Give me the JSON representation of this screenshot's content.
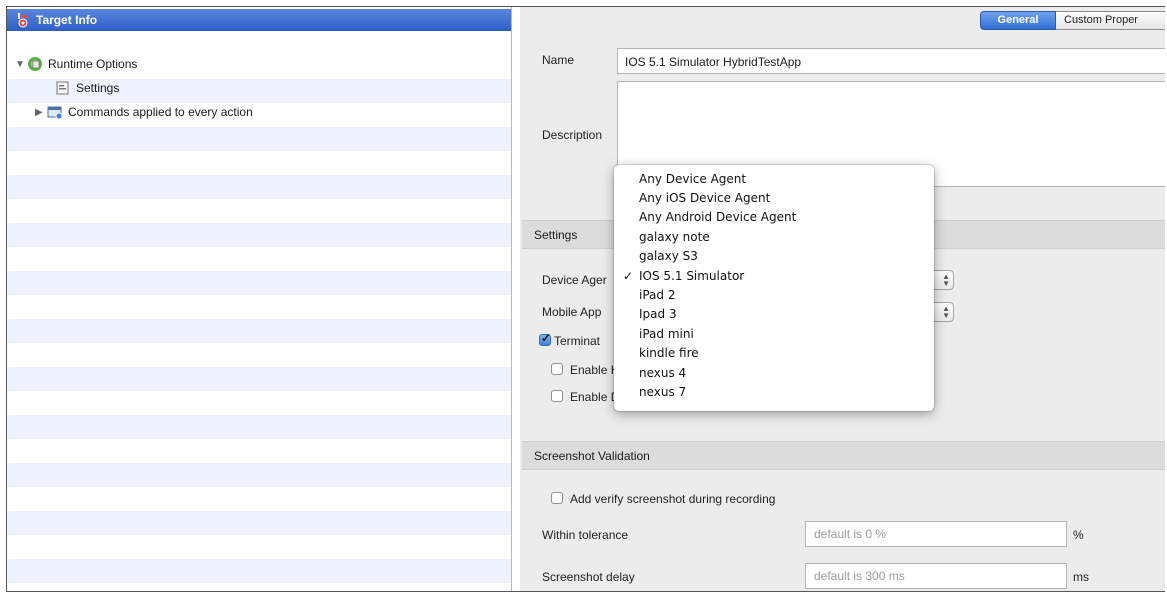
{
  "tree": {
    "selected": "Target Info",
    "items": [
      {
        "label": "Runtime Options",
        "expanded": true
      },
      {
        "label": "Settings"
      },
      {
        "label": "Commands applied to every action",
        "expanded": false
      }
    ]
  },
  "tabs": [
    {
      "label": "General",
      "active": true
    },
    {
      "label": "Custom Proper",
      "active": false
    }
  ],
  "form": {
    "name_label": "Name",
    "name_value": "IOS 5.1 Simulator HybridTestApp",
    "description_label": "Description",
    "settings_section": "Settings",
    "device_agent_label": "Device Ager",
    "mobile_app_label": "Mobile App",
    "terminate_label": "Terminat",
    "enable_h_label": "Enable H",
    "enable_d_label": "Enable D",
    "screenshot_section": "Screenshot Validation",
    "add_verify_label": "Add verify screenshot during recording",
    "tolerance_label": "Within tolerance",
    "tolerance_placeholder": "default is 0 %",
    "tolerance_unit": "%",
    "delay_label": "Screenshot delay",
    "delay_placeholder": "default is 300 ms",
    "delay_unit": "ms"
  },
  "dropdown": {
    "options": [
      "Any Device Agent",
      "Any iOS Device Agent",
      "Any Android Device Agent",
      "galaxy note",
      "galaxy S3",
      "IOS 5.1 Simulator",
      "iPad 2",
      "Ipad 3",
      "iPad mini",
      "kindle fire",
      "nexus 4",
      "nexus 7"
    ],
    "selected": "IOS 5.1 Simulator",
    "check_glyph": "✓"
  },
  "colors": {
    "selection": "#3a6ad0",
    "tab_active": "#3f7fe0",
    "row_alt": "#edf3fe"
  }
}
